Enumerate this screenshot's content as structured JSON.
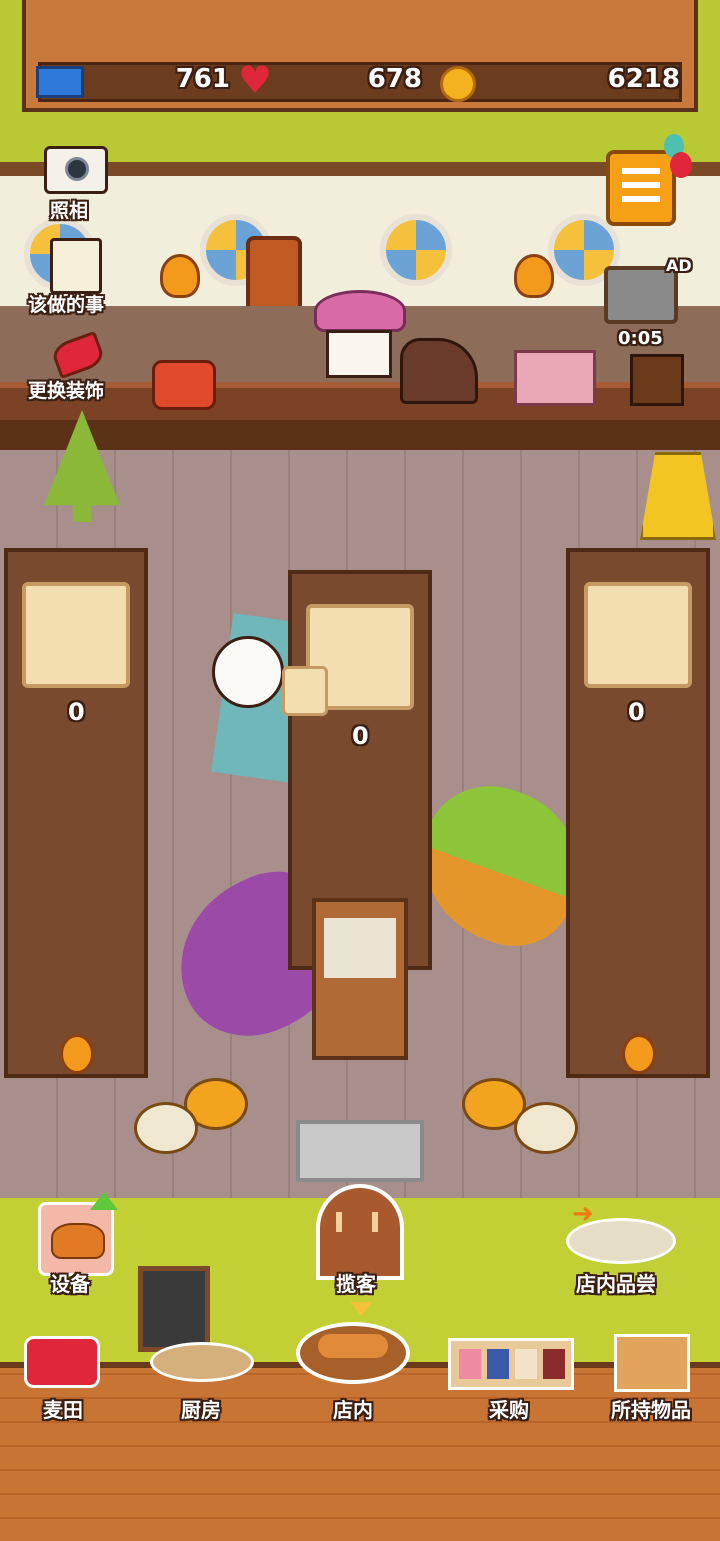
{
  "resources": {
    "tickets": "761",
    "hearts": "678",
    "coins": "6218"
  },
  "side_menu": {
    "photo": "照相",
    "todo": "该做的事",
    "decor": "更换装饰"
  },
  "ad": {
    "badge": "AD",
    "timer": "0:05"
  },
  "tables": [
    {
      "count": "0"
    },
    {
      "count": "0"
    },
    {
      "count": "0"
    }
  ],
  "actions": {
    "equipment": "设备",
    "solicit": "揽客",
    "tasting": "店内品尝"
  },
  "nav": [
    {
      "label": "麦田"
    },
    {
      "label": "厨房"
    },
    {
      "label": "店内"
    },
    {
      "label": "采购"
    },
    {
      "label": "所持物品"
    }
  ],
  "colors": {
    "grass": "#b9c933",
    "wood": "#c8793b",
    "coin": "#f5b21e",
    "heart": "#e0263a",
    "ticket": "#2f7ad9"
  }
}
